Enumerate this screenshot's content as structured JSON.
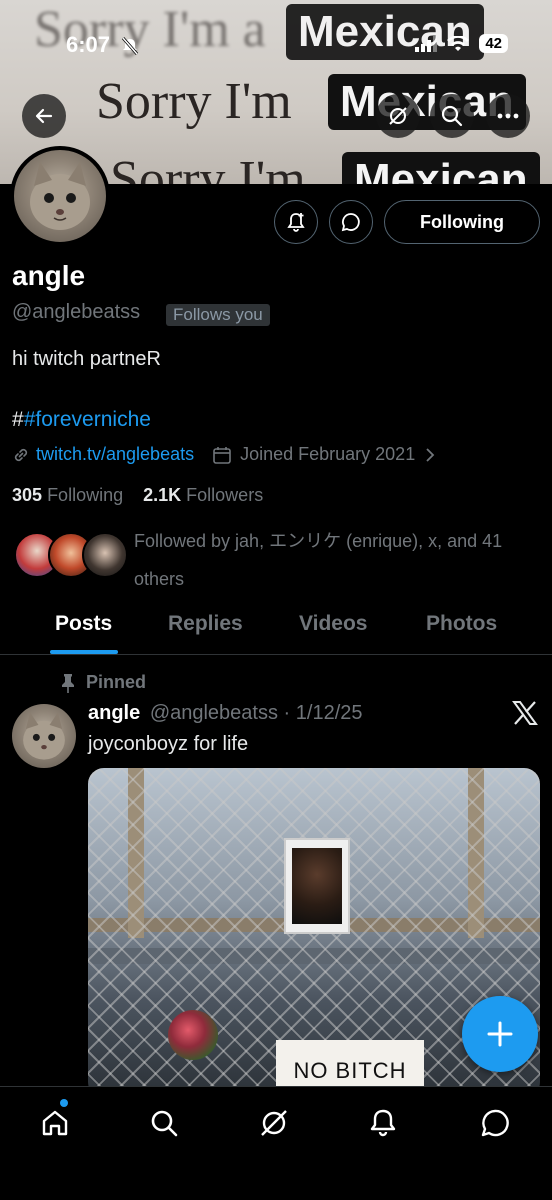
{
  "status_bar": {
    "time": "6:07",
    "battery": "42"
  },
  "banner": {
    "line_text": "Sorry I'm a",
    "box_text": "Mexican",
    "line_text_2": "Sorry I'm",
    "line_text_3": "Sorry I'm"
  },
  "profile": {
    "display_name": "angle",
    "handle": "@anglebeatss",
    "follows_you": "Follows you",
    "bio": "hi twitch partneR",
    "hashtag_prefix": "#",
    "hashtag": "#foreverniche",
    "website": "twitch.tv/anglebeats",
    "joined": "Joined February 2021",
    "following_count": "305",
    "following_label": "Following",
    "followers_count": "2.1K",
    "followers_label": "Followers",
    "followed_by": "Followed by jah, エンリケ (enrique), x, and 41 others"
  },
  "actions": {
    "following_button": "Following"
  },
  "tabs": [
    {
      "label": "Posts"
    },
    {
      "label": "Replies"
    },
    {
      "label": "Videos"
    },
    {
      "label": "Photos"
    }
  ],
  "post": {
    "pinned_label": "Pinned",
    "author_name": "angle",
    "author_handle": "@anglebeatss",
    "separator": "·",
    "date": "1/12/25",
    "text": "joyconboyz for life",
    "sign_text": "NO BITCH"
  },
  "colors": {
    "accent": "#1d9bf0",
    "background": "#000000",
    "muted": "#71767b",
    "border": "#2f3336"
  }
}
